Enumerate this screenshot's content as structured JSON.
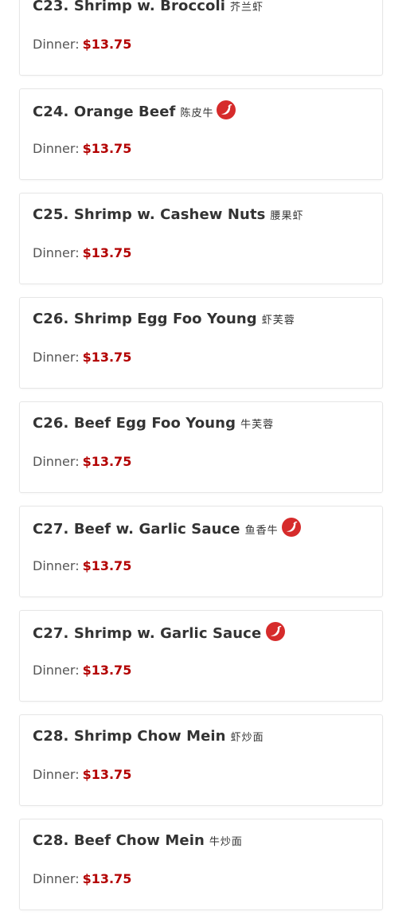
{
  "menu": {
    "items": [
      {
        "title": "C23. Shrimp w. Broccoli",
        "cn": "芥兰虾",
        "spicy": false,
        "price_label": "Dinner:",
        "price": "$13.75"
      },
      {
        "title": "C24. Orange Beef",
        "cn": "陈皮牛",
        "spicy": true,
        "price_label": "Dinner:",
        "price": "$13.75"
      },
      {
        "title": "C25. Shrimp w. Cashew Nuts",
        "cn": "腰果虾",
        "spicy": false,
        "price_label": "Dinner:",
        "price": "$13.75"
      },
      {
        "title": "C26. Shrimp Egg Foo Young",
        "cn": "虾芙蓉",
        "spicy": false,
        "price_label": "Dinner:",
        "price": "$13.75"
      },
      {
        "title": "C26. Beef Egg Foo Young",
        "cn": "牛芙蓉",
        "spicy": false,
        "price_label": "Dinner:",
        "price": "$13.75"
      },
      {
        "title": "C27. Beef w. Garlic Sauce",
        "cn": "鱼香牛",
        "spicy": true,
        "price_label": "Dinner:",
        "price": "$13.75"
      },
      {
        "title": "C27. Shrimp w. Garlic Sauce",
        "cn": "",
        "spicy": true,
        "price_label": "Dinner:",
        "price": "$13.75"
      },
      {
        "title": "C28. Shrimp Chow Mein",
        "cn": "虾炒面",
        "spicy": false,
        "price_label": "Dinner:",
        "price": "$13.75"
      },
      {
        "title": "C28. Beef Chow Mein",
        "cn": "牛炒面",
        "spicy": false,
        "price_label": "Dinner:",
        "price": "$13.75"
      }
    ]
  },
  "colors": {
    "price": "#b30000",
    "spicy_badge": "#d62b2b",
    "border": "#e6e6e6"
  },
  "icons": {
    "spicy": "chili-pepper-icon"
  }
}
